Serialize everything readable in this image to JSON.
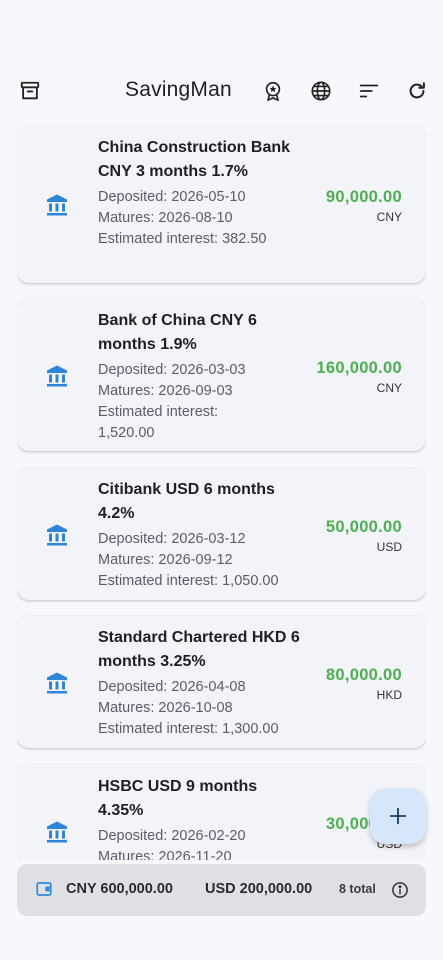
{
  "app": {
    "title": "SavingMan"
  },
  "toolbar": {
    "archive_icon": "archive-icon",
    "achievement_icon": "award-badge-icon",
    "language_icon": "globe-icon",
    "sort_icon": "sort-icon",
    "refresh_icon": "refresh-icon"
  },
  "deposits": [
    {
      "name": "China Construction Bank CNY 3 months 1.7%",
      "deposited": "Deposited: 2026-05-10",
      "matures": "Matures: 2026-08-10",
      "interest": "Estimated interest: 382.50",
      "amount": "90,000.00",
      "currency": "CNY"
    },
    {
      "name": "Bank of China CNY 6 months 1.9%",
      "deposited": "Deposited: 2026-03-03",
      "matures": "Matures: 2026-09-03",
      "interest": "Estimated interest: 1,520.00",
      "amount": "160,000.00",
      "currency": "CNY"
    },
    {
      "name": "Citibank USD 6 months 4.2%",
      "deposited": "Deposited: 2026-03-12",
      "matures": "Matures: 2026-09-12",
      "interest": "Estimated interest: 1,050.00",
      "amount": "50,000.00",
      "currency": "USD"
    },
    {
      "name": "Standard Chartered HKD 6 months 3.25%",
      "deposited": "Deposited: 2026-04-08",
      "matures": "Matures: 2026-10-08",
      "interest": "Estimated interest: 1,300.00",
      "amount": "80,000.00",
      "currency": "HKD"
    },
    {
      "name": "HSBC USD 9 months 4.35%",
      "deposited": "Deposited: 2026-02-20",
      "matures": "Matures: 2026-11-20",
      "interest": "",
      "amount": "30,000.00",
      "currency": "USD"
    }
  ],
  "fab": {
    "icon": "plus-icon"
  },
  "summary": {
    "cny_total": "CNY 600,000.00",
    "usd_total": "USD 200,000.00",
    "count": "8 total"
  },
  "colors": {
    "accent": "#2f86d8",
    "amount_green": "#4caf50",
    "fab_bg": "#d6e6fb"
  }
}
